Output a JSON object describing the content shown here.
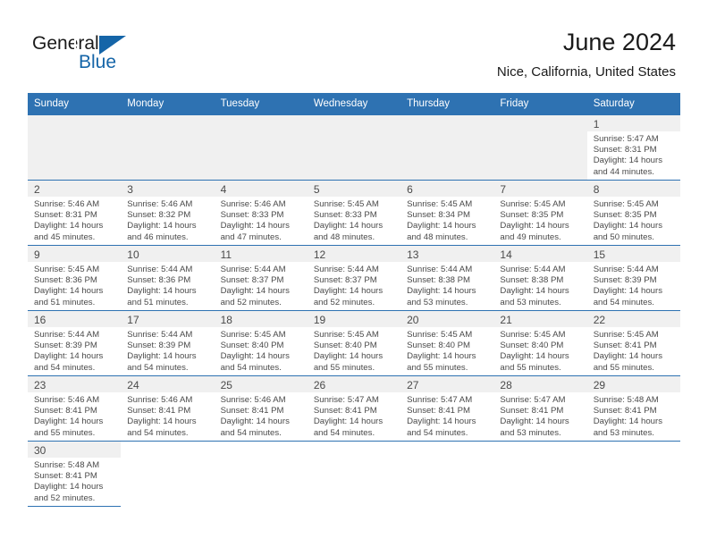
{
  "brand": {
    "name_part1": "General",
    "name_part2": "Blue",
    "logo_icon": "triangle-logo-icon"
  },
  "header": {
    "title": "June 2024",
    "location": "Nice, California, United States"
  },
  "colors": {
    "header_blue": "#2e72b2",
    "brand_blue": "#1565a8",
    "daynum_band": "#f0f0f0",
    "empty_cell": "#f0f0f0",
    "text": "#4a4a4a"
  },
  "weekdays": [
    "Sunday",
    "Monday",
    "Tuesday",
    "Wednesday",
    "Thursday",
    "Friday",
    "Saturday"
  ],
  "weeks": [
    [
      {
        "blank": true
      },
      {
        "blank": true
      },
      {
        "blank": true
      },
      {
        "blank": true
      },
      {
        "blank": true
      },
      {
        "blank": true
      },
      {
        "day": "1",
        "sunrise": "Sunrise: 5:47 AM",
        "sunset": "Sunset: 8:31 PM",
        "daylight1": "Daylight: 14 hours",
        "daylight2": "and 44 minutes."
      }
    ],
    [
      {
        "day": "2",
        "sunrise": "Sunrise: 5:46 AM",
        "sunset": "Sunset: 8:31 PM",
        "daylight1": "Daylight: 14 hours",
        "daylight2": "and 45 minutes."
      },
      {
        "day": "3",
        "sunrise": "Sunrise: 5:46 AM",
        "sunset": "Sunset: 8:32 PM",
        "daylight1": "Daylight: 14 hours",
        "daylight2": "and 46 minutes."
      },
      {
        "day": "4",
        "sunrise": "Sunrise: 5:46 AM",
        "sunset": "Sunset: 8:33 PM",
        "daylight1": "Daylight: 14 hours",
        "daylight2": "and 47 minutes."
      },
      {
        "day": "5",
        "sunrise": "Sunrise: 5:45 AM",
        "sunset": "Sunset: 8:33 PM",
        "daylight1": "Daylight: 14 hours",
        "daylight2": "and 48 minutes."
      },
      {
        "day": "6",
        "sunrise": "Sunrise: 5:45 AM",
        "sunset": "Sunset: 8:34 PM",
        "daylight1": "Daylight: 14 hours",
        "daylight2": "and 48 minutes."
      },
      {
        "day": "7",
        "sunrise": "Sunrise: 5:45 AM",
        "sunset": "Sunset: 8:35 PM",
        "daylight1": "Daylight: 14 hours",
        "daylight2": "and 49 minutes."
      },
      {
        "day": "8",
        "sunrise": "Sunrise: 5:45 AM",
        "sunset": "Sunset: 8:35 PM",
        "daylight1": "Daylight: 14 hours",
        "daylight2": "and 50 minutes."
      }
    ],
    [
      {
        "day": "9",
        "sunrise": "Sunrise: 5:45 AM",
        "sunset": "Sunset: 8:36 PM",
        "daylight1": "Daylight: 14 hours",
        "daylight2": "and 51 minutes."
      },
      {
        "day": "10",
        "sunrise": "Sunrise: 5:44 AM",
        "sunset": "Sunset: 8:36 PM",
        "daylight1": "Daylight: 14 hours",
        "daylight2": "and 51 minutes."
      },
      {
        "day": "11",
        "sunrise": "Sunrise: 5:44 AM",
        "sunset": "Sunset: 8:37 PM",
        "daylight1": "Daylight: 14 hours",
        "daylight2": "and 52 minutes."
      },
      {
        "day": "12",
        "sunrise": "Sunrise: 5:44 AM",
        "sunset": "Sunset: 8:37 PM",
        "daylight1": "Daylight: 14 hours",
        "daylight2": "and 52 minutes."
      },
      {
        "day": "13",
        "sunrise": "Sunrise: 5:44 AM",
        "sunset": "Sunset: 8:38 PM",
        "daylight1": "Daylight: 14 hours",
        "daylight2": "and 53 minutes."
      },
      {
        "day": "14",
        "sunrise": "Sunrise: 5:44 AM",
        "sunset": "Sunset: 8:38 PM",
        "daylight1": "Daylight: 14 hours",
        "daylight2": "and 53 minutes."
      },
      {
        "day": "15",
        "sunrise": "Sunrise: 5:44 AM",
        "sunset": "Sunset: 8:39 PM",
        "daylight1": "Daylight: 14 hours",
        "daylight2": "and 54 minutes."
      }
    ],
    [
      {
        "day": "16",
        "sunrise": "Sunrise: 5:44 AM",
        "sunset": "Sunset: 8:39 PM",
        "daylight1": "Daylight: 14 hours",
        "daylight2": "and 54 minutes."
      },
      {
        "day": "17",
        "sunrise": "Sunrise: 5:44 AM",
        "sunset": "Sunset: 8:39 PM",
        "daylight1": "Daylight: 14 hours",
        "daylight2": "and 54 minutes."
      },
      {
        "day": "18",
        "sunrise": "Sunrise: 5:45 AM",
        "sunset": "Sunset: 8:40 PM",
        "daylight1": "Daylight: 14 hours",
        "daylight2": "and 54 minutes."
      },
      {
        "day": "19",
        "sunrise": "Sunrise: 5:45 AM",
        "sunset": "Sunset: 8:40 PM",
        "daylight1": "Daylight: 14 hours",
        "daylight2": "and 55 minutes."
      },
      {
        "day": "20",
        "sunrise": "Sunrise: 5:45 AM",
        "sunset": "Sunset: 8:40 PM",
        "daylight1": "Daylight: 14 hours",
        "daylight2": "and 55 minutes."
      },
      {
        "day": "21",
        "sunrise": "Sunrise: 5:45 AM",
        "sunset": "Sunset: 8:40 PM",
        "daylight1": "Daylight: 14 hours",
        "daylight2": "and 55 minutes."
      },
      {
        "day": "22",
        "sunrise": "Sunrise: 5:45 AM",
        "sunset": "Sunset: 8:41 PM",
        "daylight1": "Daylight: 14 hours",
        "daylight2": "and 55 minutes."
      }
    ],
    [
      {
        "day": "23",
        "sunrise": "Sunrise: 5:46 AM",
        "sunset": "Sunset: 8:41 PM",
        "daylight1": "Daylight: 14 hours",
        "daylight2": "and 55 minutes."
      },
      {
        "day": "24",
        "sunrise": "Sunrise: 5:46 AM",
        "sunset": "Sunset: 8:41 PM",
        "daylight1": "Daylight: 14 hours",
        "daylight2": "and 54 minutes."
      },
      {
        "day": "25",
        "sunrise": "Sunrise: 5:46 AM",
        "sunset": "Sunset: 8:41 PM",
        "daylight1": "Daylight: 14 hours",
        "daylight2": "and 54 minutes."
      },
      {
        "day": "26",
        "sunrise": "Sunrise: 5:47 AM",
        "sunset": "Sunset: 8:41 PM",
        "daylight1": "Daylight: 14 hours",
        "daylight2": "and 54 minutes."
      },
      {
        "day": "27",
        "sunrise": "Sunrise: 5:47 AM",
        "sunset": "Sunset: 8:41 PM",
        "daylight1": "Daylight: 14 hours",
        "daylight2": "and 54 minutes."
      },
      {
        "day": "28",
        "sunrise": "Sunrise: 5:47 AM",
        "sunset": "Sunset: 8:41 PM",
        "daylight1": "Daylight: 14 hours",
        "daylight2": "and 53 minutes."
      },
      {
        "day": "29",
        "sunrise": "Sunrise: 5:48 AM",
        "sunset": "Sunset: 8:41 PM",
        "daylight1": "Daylight: 14 hours",
        "daylight2": "and 53 minutes."
      }
    ],
    [
      {
        "day": "30",
        "sunrise": "Sunrise: 5:48 AM",
        "sunset": "Sunset: 8:41 PM",
        "daylight1": "Daylight: 14 hours",
        "daylight2": "and 52 minutes."
      },
      {
        "tail": true
      },
      {
        "tail": true
      },
      {
        "tail": true
      },
      {
        "tail": true
      },
      {
        "tail": true
      },
      {
        "tail": true
      }
    ]
  ]
}
